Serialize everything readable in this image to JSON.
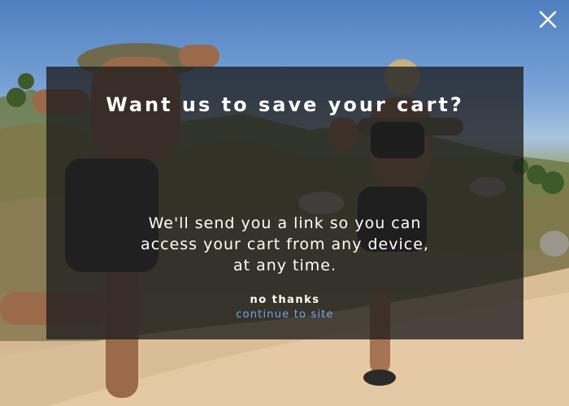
{
  "modal": {
    "title": "Want us to save your cart?",
    "message_lines": [
      "We'll send you a link so you can",
      "access your cart from any device,",
      "at any time."
    ],
    "no_thanks_label": "no thanks",
    "continue_label": "continue to site"
  },
  "close": {
    "icon": "close-icon"
  },
  "colors": {
    "overlay": "#1e1e1e",
    "link": "#6aa8e8",
    "text": "#ffffff"
  }
}
